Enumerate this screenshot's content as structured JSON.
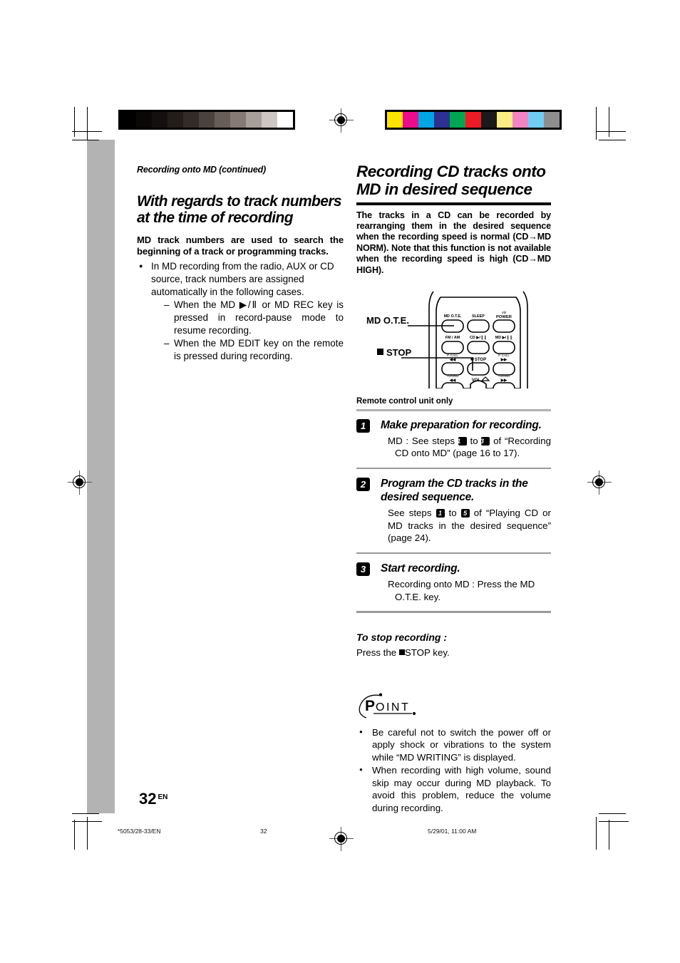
{
  "prepress": {
    "grayscale_swatches": [
      "#000000",
      "#0a0707",
      "#151010",
      "#231d1a",
      "#332b27",
      "#4c423d",
      "#685d57",
      "#857a74",
      "#a79f9a",
      "#cdc7c3",
      "#ffffff"
    ],
    "color_swatches": [
      "#ffe400",
      "#ec0d8c",
      "#00a5e3",
      "#2e3192",
      "#00a651",
      "#ed1c24",
      "#1a1a1a",
      "#fbec84",
      "#f285c1",
      "#72cdf4",
      "#8e8e8e"
    ]
  },
  "header": {
    "kicker": "Recording onto MD (continued)"
  },
  "left_column": {
    "section_title": "With regards to track numbers at the time of recording",
    "lead": "MD track numbers are used to search the beginning of a track or programming tracks.",
    "bullet": "In MD recording from the radio,  AUX or CD source, track numbers are assigned automatically in the following cases.",
    "sub_bullets": [
      "When the MD ▶/Ⅱ or MD REC key is pressed in record-pause mode to resume recording.",
      "When the MD EDIT key on the remote is pressed during recording."
    ]
  },
  "right_column": {
    "title": "Recording CD tracks onto MD in desired sequence",
    "intro": "The tracks in a CD can be recorded by rearranging them in the desired sequence when the recording speed is normal (CD→MD NORM). Note that this function is not available when the recording speed is high (CD→MD HIGH).",
    "figure": {
      "callout_md_ote": "MD O.T.E.",
      "callout_stop": "STOP",
      "buttons_row1": [
        "MD O.T.E.",
        "SLEEP",
        "POWER"
      ],
      "buttons_row2": [
        "FM / AM",
        "CD ▶/Ⅱ",
        "MD ▶/Ⅱ"
      ],
      "buttons_row3": [
        "P. CALL",
        "■ STOP",
        "P. CALL"
      ],
      "buttons_row4": [
        "TUNING",
        "VOL",
        "TUNING"
      ]
    },
    "remote_only_note": "Remote control unit only",
    "steps": [
      {
        "num": "1",
        "title": "Make preparation for recording.",
        "body_pre": "MD : See steps ",
        "body_mid": " to ",
        "body_post": " of “Recording CD onto MD” (page 16 to 17).",
        "ref_from": "1",
        "ref_to": "3"
      },
      {
        "num": "2",
        "title": "Program the CD tracks in the desired sequence.",
        "body_pre": "See steps ",
        "body_mid": " to ",
        "body_post": " of “Playing CD or MD tracks in the desired sequence” (page 24).",
        "ref_from": "1",
        "ref_to": "5"
      },
      {
        "num": "3",
        "title": "Start recording.",
        "body_pre": "Recording onto MD  : Press the MD O.T.E. key.",
        "body_mid": "",
        "body_post": "",
        "ref_from": "",
        "ref_to": ""
      }
    ],
    "stop_heading": "To stop recording :",
    "stop_text_pre": "Press the ",
    "stop_text_post": "STOP key.",
    "point_label": "POINT",
    "point_items": [
      "Be careful not to switch the power off or apply shock or vibrations to the system while “MD WRITING” is displayed.",
      "When recording with high volume, sound skip may occur during MD playback. To avoid this problem, reduce the volume during recording."
    ]
  },
  "page_number": "32",
  "page_number_sup": "EN",
  "footer": {
    "left": "*5053/28-33/EN",
    "center": "32",
    "right": "5/29/01, 11:00 AM"
  }
}
